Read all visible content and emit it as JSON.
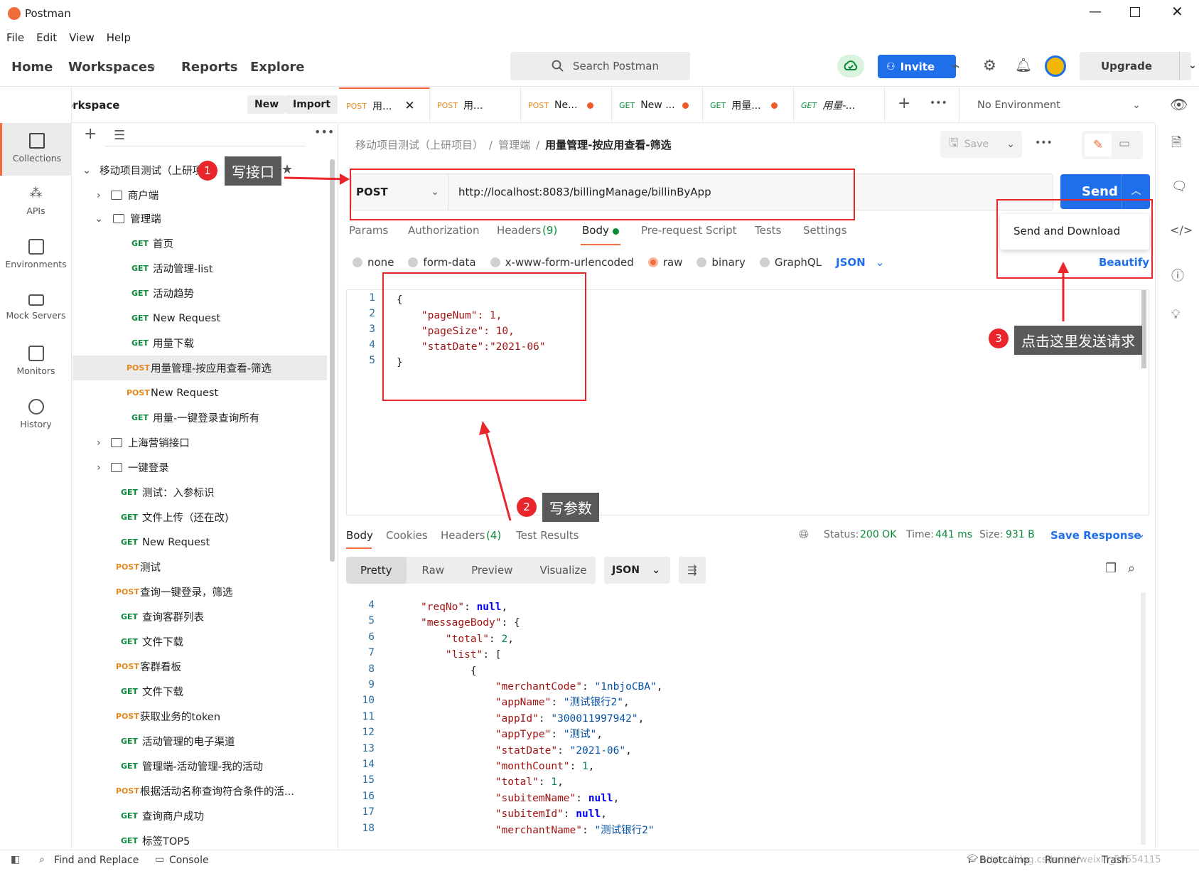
{
  "window": {
    "title": "Postman"
  },
  "menu": [
    "File",
    "Edit",
    "View",
    "Help"
  ],
  "nav": {
    "home": "Home",
    "workspaces": "Workspaces",
    "reports": "Reports",
    "explore": "Explore",
    "search_placeholder": "Search Postman",
    "invite": "Invite",
    "upgrade": "Upgrade"
  },
  "workspace": {
    "name": "My Workspace",
    "new": "New",
    "import": "Import"
  },
  "rail": [
    "Collections",
    "APIs",
    "Environments",
    "Mock Servers",
    "Monitors",
    "History"
  ],
  "tree": {
    "collection": "移动项目测试（上研项目）",
    "folders": [
      "商户端",
      "管理端"
    ],
    "items": [
      {
        "m": "GET",
        "t": "首页"
      },
      {
        "m": "GET",
        "t": "活动管理-list"
      },
      {
        "m": "GET",
        "t": "活动趋势"
      },
      {
        "m": "GET",
        "t": "New Request"
      },
      {
        "m": "GET",
        "t": "用量下载"
      },
      {
        "m": "POST",
        "t": "用量管理-按应用查看-筛选"
      },
      {
        "m": "POST",
        "t": "New Request"
      },
      {
        "m": "GET",
        "t": "用量-一键登录查询所有"
      }
    ],
    "folders2": [
      "上海营销接口",
      "一键登录"
    ],
    "rootitems": [
      {
        "m": "GET",
        "t": "测试：入参标识"
      },
      {
        "m": "GET",
        "t": "文件上传（还在改)"
      },
      {
        "m": "GET",
        "t": "New Request"
      },
      {
        "m": "POST",
        "t": "测试"
      },
      {
        "m": "POST",
        "t": "查询一键登录，筛选"
      },
      {
        "m": "GET",
        "t": "查询客群列表"
      },
      {
        "m": "GET",
        "t": "文件下载"
      },
      {
        "m": "POST",
        "t": "客群看板"
      },
      {
        "m": "GET",
        "t": "文件下载"
      },
      {
        "m": "POST",
        "t": "获取业务的token"
      },
      {
        "m": "GET",
        "t": "活动管理的电子渠道"
      },
      {
        "m": "GET",
        "t": "管理端-活动管理-我的活动"
      },
      {
        "m": "POST",
        "t": "根据活动名称查询符合条件的活..."
      },
      {
        "m": "GET",
        "t": "查询商户成功"
      },
      {
        "m": "GET",
        "t": "标签TOP5"
      }
    ]
  },
  "tabs": [
    {
      "m": "POST",
      "t": "用..."
    },
    {
      "m": "POST",
      "t": "用..."
    },
    {
      "m": "POST",
      "t": "Ne..."
    },
    {
      "m": "GET",
      "t": "New ..."
    },
    {
      "m": "GET",
      "t": "用量..."
    },
    {
      "m": "GET",
      "t": "用量-..."
    }
  ],
  "env": "No Environment",
  "breadcrumb": {
    "a": "移动项目测试（上研项目）",
    "b": "管理端",
    "c": "用量管理-按应用查看-筛选"
  },
  "save": "Save",
  "request": {
    "method": "POST",
    "url": "http://localhost:8083/billingManage/billinByApp",
    "send": "Send",
    "send_download": "Send and Download",
    "beautify": "Beautify"
  },
  "reqtabs": {
    "params": "Params",
    "auth": "Authorization",
    "headers": "Headers",
    "headers_count": "(9)",
    "body": "Body",
    "prereq": "Pre-request Script",
    "tests": "Tests",
    "settings": "Settings"
  },
  "bodytypes": {
    "none": "none",
    "formdata": "form-data",
    "urlenc": "x-www-form-urlencoded",
    "raw": "raw",
    "binary": "binary",
    "graphql": "GraphQL",
    "json": "JSON"
  },
  "reqbody": [
    "{",
    "    \"pageNum\": 1,",
    "    \"pageSize\": 10,",
    "    \"statDate\":\"2021-06\"",
    "}"
  ],
  "annotations": {
    "a1": "写接口",
    "a2": "写参数",
    "a3": "点击这里发送请求",
    "n1": "1",
    "n2": "2",
    "n3": "3"
  },
  "resp": {
    "body": "Body",
    "cookies": "Cookies",
    "headers": "Headers",
    "headers_count": "(4)",
    "tests": "Test Results",
    "status_l": "Status:",
    "status": "200 OK",
    "time_l": "Time:",
    "time": "441 ms",
    "size_l": "Size:",
    "size": "931 B",
    "save": "Save Response",
    "pretty": "Pretty",
    "raw": "Raw",
    "preview": "Preview",
    "visualize": "Visualize",
    "json": "JSON"
  },
  "status": {
    "find": "Find and Replace",
    "console": "Console",
    "bootcamp": "Bootcamp",
    "runner": "Runner",
    "trash": "Trash",
    "watermark": "https://blog.csdn.net/weixin_55554115"
  }
}
